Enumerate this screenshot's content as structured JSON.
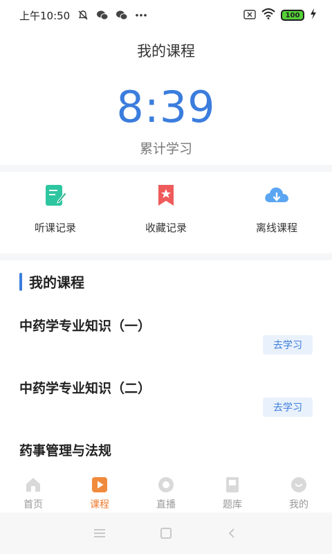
{
  "status_bar": {
    "time": "上午10:50",
    "battery": "100"
  },
  "header": {
    "title": "我的课程",
    "study_time": "8:39",
    "study_caption": "累计学习"
  },
  "shortcuts": [
    {
      "label": "听课记录",
      "icon": "note-edit-icon",
      "color": "#2ec6a0"
    },
    {
      "label": "收藏记录",
      "icon": "bookmark-star-icon",
      "color": "#ef5a5a"
    },
    {
      "label": "离线课程",
      "icon": "cloud-download-icon",
      "color": "#5aa6f2"
    }
  ],
  "section": {
    "title": "我的课程"
  },
  "courses": [
    {
      "name": "中药学专业知识（一）",
      "action": "去学习"
    },
    {
      "name": "中药学专业知识（二）",
      "action": "去学习"
    },
    {
      "name": "药事管理与法规"
    }
  ],
  "tabs": [
    {
      "label": "首页",
      "icon": "home-icon",
      "active": false
    },
    {
      "label": "课程",
      "icon": "play-icon",
      "active": true
    },
    {
      "label": "直播",
      "icon": "live-icon",
      "active": false
    },
    {
      "label": "题库",
      "icon": "question-bank-icon",
      "active": false
    },
    {
      "label": "我的",
      "icon": "profile-icon",
      "active": false
    }
  ],
  "colors": {
    "accent": "#3b7ddd",
    "tab_active": "#ee7a2d",
    "tab_inactive": "#999999"
  }
}
